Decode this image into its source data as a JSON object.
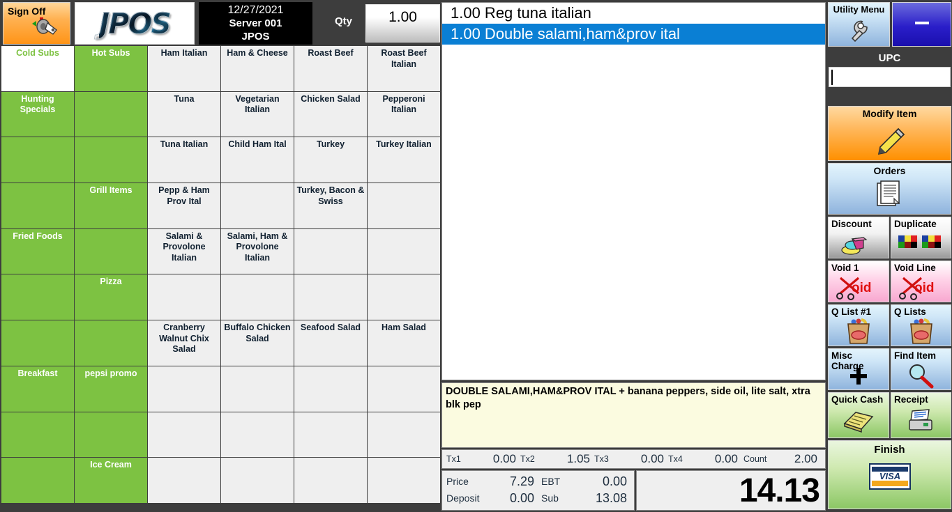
{
  "header": {
    "sign_off_label": "Sign Off",
    "sign_off_icon": "key-icon",
    "logo_text": "JPOS",
    "date": "12/27/2021",
    "server": "Server 001",
    "store": "JPOS",
    "qty_label": "Qty",
    "qty_value": "1.00"
  },
  "categories": [
    {
      "label": "Cold Subs",
      "selected": true
    },
    {
      "label": "Hot Subs",
      "selected": false
    },
    {
      "label": "Hunting Specials",
      "selected": false
    },
    {
      "label": "",
      "selected": false
    },
    {
      "label": "",
      "selected": false
    },
    {
      "label": "",
      "selected": false
    },
    {
      "label": "",
      "selected": false
    },
    {
      "label": "Grill Items",
      "selected": false
    },
    {
      "label": "Fried Foods",
      "selected": false
    },
    {
      "label": "",
      "selected": false
    },
    {
      "label": "",
      "selected": false
    },
    {
      "label": "Pizza",
      "selected": false
    },
    {
      "label": "",
      "selected": false
    },
    {
      "label": "",
      "selected": false
    },
    {
      "label": "Breakfast",
      "selected": false
    },
    {
      "label": "pepsi promo",
      "selected": false
    },
    {
      "label": "",
      "selected": false
    },
    {
      "label": "",
      "selected": false
    },
    {
      "label": "",
      "selected": false
    },
    {
      "label": "Ice Cream",
      "selected": false
    }
  ],
  "products": [
    [
      "Ham Italian",
      "Ham & Cheese",
      "Roast Beef",
      "Roast Beef Italian"
    ],
    [
      "Tuna",
      "Vegetarian Italian",
      "Chicken Salad",
      "Pepperoni Italian"
    ],
    [
      "Tuna Italian",
      "Child Ham Ital",
      "Turkey",
      "Turkey Italian"
    ],
    [
      "Pepp & Ham Prov Ital",
      "",
      "Turkey, Bacon & Swiss",
      ""
    ],
    [
      "Salami & Provolone Italian",
      "Salami, Ham & Provolone Italian",
      "",
      ""
    ],
    [
      "",
      "",
      "",
      ""
    ],
    [
      "Cranberry Walnut Chix Salad",
      "Buffalo Chicken Salad",
      "Seafood Salad",
      "Ham Salad"
    ],
    [
      "",
      "",
      "",
      ""
    ],
    [
      "",
      "",
      "",
      ""
    ],
    [
      "",
      "",
      "",
      ""
    ]
  ],
  "receipt": {
    "items": [
      {
        "qty": "1.00",
        "name": "Reg tuna italian",
        "selected": false
      },
      {
        "qty": "1.00",
        "name": "Double salami,ham&prov ital",
        "selected": true
      }
    ]
  },
  "modifiers": {
    "text": "DOUBLE SALAMI,HAM&PROV ITAL + banana peppers, side oil, lite salt, xtra blk pep"
  },
  "tax_row": {
    "tx1_label": "Tx1",
    "tx1_value": "0.00",
    "tx2_label": "Tx2",
    "tx2_value": "1.05",
    "tx3_label": "Tx3",
    "tx3_value": "0.00",
    "tx4_label": "Tx4",
    "tx4_value": "0.00",
    "count_label": "Count",
    "count_value": "2.00"
  },
  "totals": {
    "price_label": "Price",
    "price_value": "7.29",
    "deposit_label": "Deposit",
    "deposit_value": "0.00",
    "ebt_label": "EBT",
    "ebt_value": "0.00",
    "sub_label": "Sub",
    "sub_value": "13.08",
    "grand_total": "14.13"
  },
  "sidebar": {
    "utility_menu": {
      "label": "Utility Menu",
      "icon": "wrench-icon"
    },
    "minimize": {
      "label": "—",
      "icon": "minimize-icon"
    },
    "upc_label": "UPC",
    "upc_value": "",
    "modify_item": {
      "label": "Modify Item",
      "icon": "pencil-icon"
    },
    "orders": {
      "label": "Orders",
      "icon": "documents-icon"
    },
    "discount": {
      "label": "Discount",
      "icon": "pie-chart-icon"
    },
    "duplicate": {
      "label": "Duplicate",
      "icon": "color-blocks-icon"
    },
    "void1": {
      "label": "Void 1",
      "icon": "scissors-void-icon",
      "mark": "oid"
    },
    "void_line": {
      "label": "Void Line",
      "icon": "scissors-void-icon",
      "mark": "oid"
    },
    "q_list_1": {
      "label": "Q List #1",
      "icon": "grocery-bag-icon"
    },
    "q_lists": {
      "label": "Q Lists",
      "icon": "grocery-bag-icon"
    },
    "misc_charge": {
      "label": "Misc Charge",
      "icon": "plus-icon"
    },
    "find_item": {
      "label": "Find Item",
      "icon": "magnifier-icon"
    },
    "quick_cash": {
      "label": "Quick Cash",
      "icon": "cash-drawer-icon"
    },
    "receipt_btn": {
      "label": "Receipt",
      "icon": "printer-icon"
    },
    "finish": {
      "label": "Finish",
      "icon": "visa-card-icon",
      "card_text": "VISA"
    }
  },
  "colors": {
    "category_green": "#7dc242",
    "selection_blue": "#0a7fd4",
    "accent_orange": "#ff9000",
    "background": "#3d3d3d",
    "modifier_yellow": "#fbfbe0"
  }
}
